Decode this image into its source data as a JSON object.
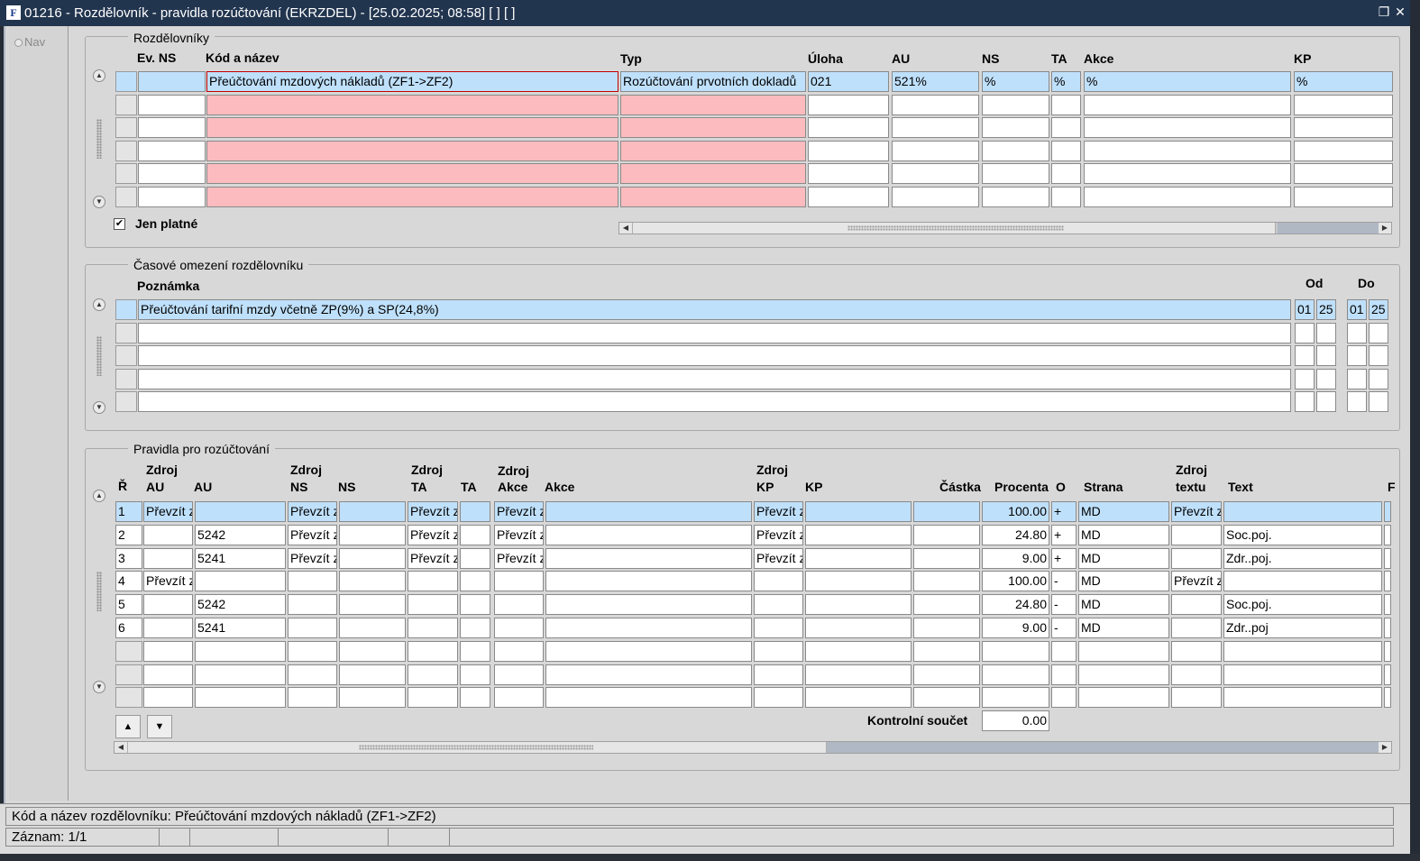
{
  "window": {
    "app_code": "F",
    "title": "01216 - Rozdělovník - pravidla rozúčtování (EKRZDEL) - [25.02.2025; 08:58]  [ ]  [ ]",
    "restore_glyph": "❐",
    "close_glyph": "✕"
  },
  "nav": {
    "label": "Nav"
  },
  "rozdelovniky": {
    "title": "Rozdělovníky",
    "headers": {
      "ev_ns": "Ev. NS",
      "kod": "Kód a název",
      "typ": "Typ",
      "uloha": "Úloha",
      "au": "AU",
      "ns": "NS",
      "ta": "TA",
      "akce": "Akce",
      "kp": "KP"
    },
    "rows": [
      {
        "ev_ns": "",
        "kod": "Přeúčtování mzdových nákladů (ZF1->ZF2)",
        "typ": "Rozúčtování prvotních dokladů",
        "uloha": "021",
        "au": "521%",
        "ns": "%",
        "ta": "%",
        "akce": "%",
        "kp": "%"
      },
      {
        "ev_ns": "",
        "kod": "",
        "typ": "",
        "uloha": "",
        "au": "",
        "ns": "",
        "ta": "",
        "akce": "",
        "kp": ""
      },
      {
        "ev_ns": "",
        "kod": "",
        "typ": "",
        "uloha": "",
        "au": "",
        "ns": "",
        "ta": "",
        "akce": "",
        "kp": ""
      },
      {
        "ev_ns": "",
        "kod": "",
        "typ": "",
        "uloha": "",
        "au": "",
        "ns": "",
        "ta": "",
        "akce": "",
        "kp": ""
      },
      {
        "ev_ns": "",
        "kod": "",
        "typ": "",
        "uloha": "",
        "au": "",
        "ns": "",
        "ta": "",
        "akce": "",
        "kp": ""
      },
      {
        "ev_ns": "",
        "kod": "",
        "typ": "",
        "uloha": "",
        "au": "",
        "ns": "",
        "ta": "",
        "akce": "",
        "kp": ""
      }
    ],
    "jen_platne_label": "Jen platné",
    "jen_platne_checked": true
  },
  "casove": {
    "title": "Časové omezení rozdělovníku",
    "headers": {
      "poznamka": "Poznámka",
      "od": "Od",
      "do": "Do"
    },
    "rows": [
      {
        "poznamka": "Přeúčtování tarifní mzdy včetně ZP(9%) a SP(24,8%)",
        "od1": "01",
        "od2": "25",
        "do1": "01",
        "do2": "25"
      },
      {
        "poznamka": "",
        "od1": "",
        "od2": "",
        "do1": "",
        "do2": ""
      },
      {
        "poznamka": "",
        "od1": "",
        "od2": "",
        "do1": "",
        "do2": ""
      },
      {
        "poznamka": "",
        "od1": "",
        "od2": "",
        "do1": "",
        "do2": ""
      },
      {
        "poznamka": "",
        "od1": "",
        "od2": "",
        "do1": "",
        "do2": ""
      }
    ]
  },
  "pravidla": {
    "title": "Pravidla pro rozúčtování",
    "headers": {
      "r": "Ř",
      "zdroj_au_1": "Zdroj",
      "zdroj_au_2": "AU",
      "au": "AU",
      "zdroj_ns_1": "Zdroj",
      "zdroj_ns_2": "NS",
      "ns": "NS",
      "zdroj_ta_1": "Zdroj",
      "zdroj_ta_2": "TA",
      "ta": "TA",
      "zdroj_akce_1": "Zdroj",
      "zdroj_akce_2": "Akce",
      "akce": "Akce",
      "zdroj_kp_1": "Zdroj",
      "zdroj_kp_2": "KP",
      "kp": "KP",
      "castka": "Částka",
      "procenta": "Procenta",
      "o": "O",
      "strana": "Strana",
      "zdroj_textu_1": "Zdroj",
      "zdroj_textu_2": "textu",
      "text": "Text",
      "cut": "F"
    },
    "rows": [
      {
        "r": "1",
        "zdroj_au": "Převzít z",
        "au": "",
        "zdroj_ns": "Převzít z",
        "ns": "",
        "zdroj_ta": "Převzít z",
        "ta": "",
        "zdroj_akce": "Převzít z",
        "akce": "",
        "zdroj_kp": "Převzít z",
        "kp": "",
        "castka": "",
        "procenta": "100.00",
        "o": "+",
        "strana": "MD",
        "zdroj_textu": "Převzít z",
        "text": ""
      },
      {
        "r": "2",
        "zdroj_au": "",
        "au": "5242",
        "zdroj_ns": "Převzít z",
        "ns": "",
        "zdroj_ta": "Převzít z",
        "ta": "",
        "zdroj_akce": "Převzít z",
        "akce": "",
        "zdroj_kp": "Převzít z",
        "kp": "",
        "castka": "",
        "procenta": "24.80",
        "o": "+",
        "strana": "MD",
        "zdroj_textu": "",
        "text": "Soc.poj."
      },
      {
        "r": "3",
        "zdroj_au": "",
        "au": "5241",
        "zdroj_ns": "Převzít z",
        "ns": "",
        "zdroj_ta": "Převzít z",
        "ta": "",
        "zdroj_akce": "Převzít z",
        "akce": "",
        "zdroj_kp": "Převzít z",
        "kp": "",
        "castka": "",
        "procenta": "9.00",
        "o": "+",
        "strana": "MD",
        "zdroj_textu": "",
        "text": "Zdr..poj."
      },
      {
        "r": "4",
        "zdroj_au": "Převzít z",
        "au": "",
        "zdroj_ns": "",
        "ns": "",
        "zdroj_ta": "",
        "ta": "",
        "zdroj_akce": "",
        "akce": "",
        "zdroj_kp": "",
        "kp": "",
        "castka": "",
        "procenta": "100.00",
        "o": "-",
        "strana": "MD",
        "zdroj_textu": "Převzít z",
        "text": ""
      },
      {
        "r": "5",
        "zdroj_au": "",
        "au": "5242",
        "zdroj_ns": "",
        "ns": "",
        "zdroj_ta": "",
        "ta": "",
        "zdroj_akce": "",
        "akce": "",
        "zdroj_kp": "",
        "kp": "",
        "castka": "",
        "procenta": "24.80",
        "o": "-",
        "strana": "MD",
        "zdroj_textu": "",
        "text": "Soc.poj."
      },
      {
        "r": "6",
        "zdroj_au": "",
        "au": "5241",
        "zdroj_ns": "",
        "ns": "",
        "zdroj_ta": "",
        "ta": "",
        "zdroj_akce": "",
        "akce": "",
        "zdroj_kp": "",
        "kp": "",
        "castka": "",
        "procenta": "9.00",
        "o": "-",
        "strana": "MD",
        "zdroj_textu": "",
        "text": "Zdr..poj"
      },
      {
        "r": "",
        "zdroj_au": "",
        "au": "",
        "zdroj_ns": "",
        "ns": "",
        "zdroj_ta": "",
        "ta": "",
        "zdroj_akce": "",
        "akce": "",
        "zdroj_kp": "",
        "kp": "",
        "castka": "",
        "procenta": "",
        "o": "",
        "strana": "",
        "zdroj_textu": "",
        "text": ""
      },
      {
        "r": "",
        "zdroj_au": "",
        "au": "",
        "zdroj_ns": "",
        "ns": "",
        "zdroj_ta": "",
        "ta": "",
        "zdroj_akce": "",
        "akce": "",
        "zdroj_kp": "",
        "kp": "",
        "castka": "",
        "procenta": "",
        "o": "",
        "strana": "",
        "zdroj_textu": "",
        "text": ""
      },
      {
        "r": "",
        "zdroj_au": "",
        "au": "",
        "zdroj_ns": "",
        "ns": "",
        "zdroj_ta": "",
        "ta": "",
        "zdroj_akce": "",
        "akce": "",
        "zdroj_kp": "",
        "kp": "",
        "castka": "",
        "procenta": "",
        "o": "",
        "strana": "",
        "zdroj_textu": "",
        "text": ""
      }
    ],
    "kontrolni_label": "Kontrolní součet",
    "kontrolni_value": "0.00"
  },
  "status": {
    "line1": "Kód a název rozdělovníku: Přeúčtování mzdových nákladů (ZF1->ZF2)",
    "record": "Záznam: 1/1"
  },
  "colors": {
    "selected_row": "#bfe0fb",
    "required_field": "#fcbcbf",
    "title_bar": "#22354f",
    "form_bg": "#d8d8d8"
  },
  "icons": {
    "up": "▲",
    "down": "▼",
    "left": "◀",
    "right": "▶",
    "check": "✔"
  }
}
